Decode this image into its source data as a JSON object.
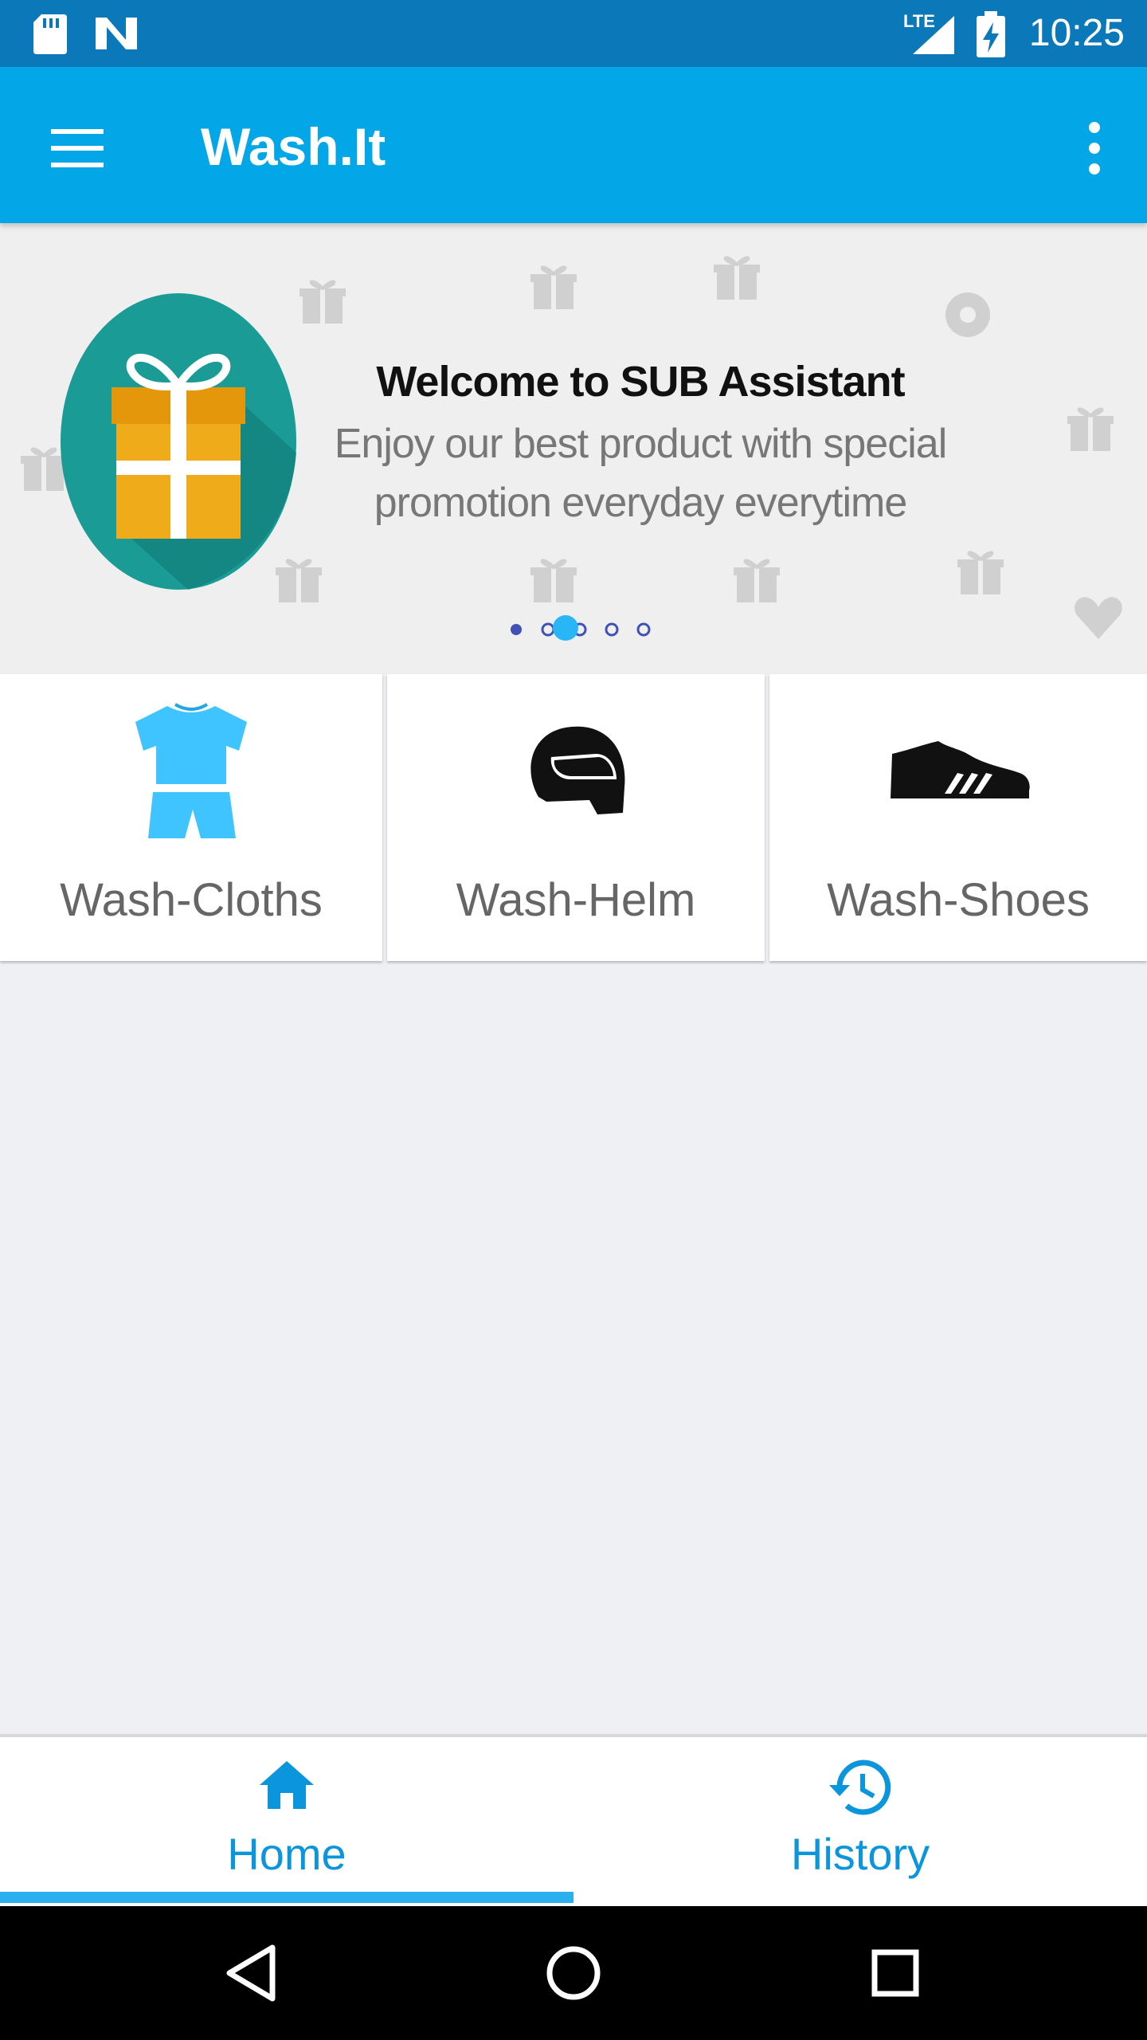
{
  "status_bar": {
    "time": "10:25",
    "network": "LTE",
    "icons": [
      "sd-card-icon",
      "notification-n-icon",
      "signal-icon",
      "battery-charging-icon"
    ]
  },
  "app_bar": {
    "title": "Wash.It",
    "menu_icon": "hamburger-menu-icon",
    "overflow_icon": "more-vert-icon"
  },
  "banner": {
    "title": "Welcome to SUB Assistant",
    "subtitle_line1": "Enjoy our best product with special",
    "subtitle_line2": "promotion everyday everytime",
    "page_count": 5,
    "active_page": 2
  },
  "services": [
    {
      "label": "Wash-Cloths",
      "icon": "clothes-icon"
    },
    {
      "label": "Wash-Helm",
      "icon": "helmet-icon"
    },
    {
      "label": "Wash-Shoes",
      "icon": "shoe-icon"
    }
  ],
  "bottom_nav": {
    "tabs": [
      {
        "label": "Home",
        "icon": "home-icon",
        "selected": true
      },
      {
        "label": "History",
        "icon": "history-icon",
        "selected": false
      }
    ]
  },
  "colors": {
    "status_bar": "#0a78b9",
    "app_bar": "#03a6e6",
    "accent": "#0a95dd",
    "background": "#eef0f3"
  }
}
